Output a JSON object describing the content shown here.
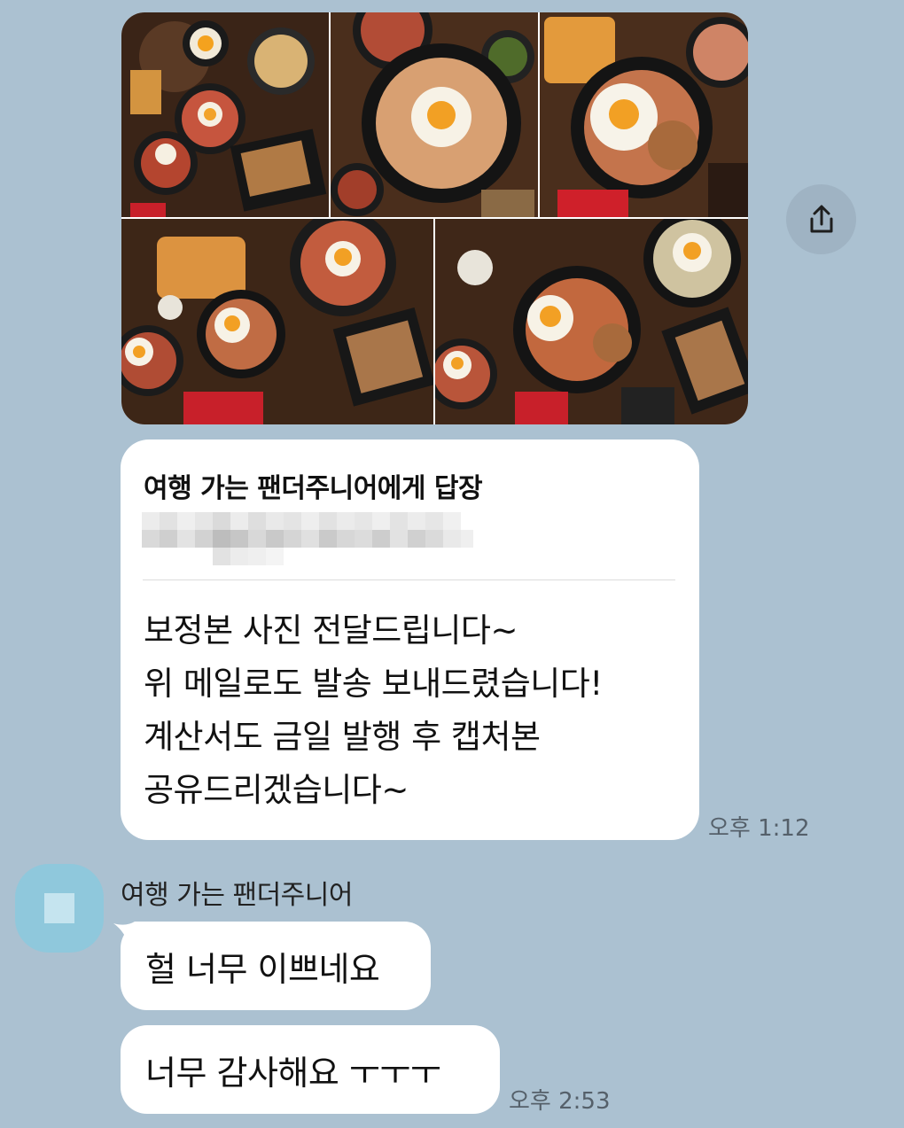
{
  "photos": [
    {
      "alt": "food-photo-1"
    },
    {
      "alt": "food-photo-2"
    },
    {
      "alt": "food-photo-3"
    },
    {
      "alt": "food-photo-4"
    },
    {
      "alt": "food-photo-5"
    }
  ],
  "share_icon": "share-upload-icon",
  "reply": {
    "title": "여행 가는 팬더주니어에게 답장",
    "lines": [
      "보정본 사진 전달드립니다~",
      "위 메일로도 발송 보내드렸습니다!",
      "계산서도 금일 발행 후 캡처본",
      "공유드리겠습니다~"
    ],
    "time": "오후 1:12"
  },
  "incoming": {
    "sender": "여행 가는 팬더주니어",
    "messages": [
      {
        "text": "헐 너무 이쁘네요"
      },
      {
        "text": "너무 감사해요 ㅜㅜㅜ"
      }
    ],
    "time": "오후 2:53"
  },
  "colors": {
    "background": "#abc1d1",
    "bubble": "#ffffff",
    "avatar": "#8fc8dc",
    "share_button": "#9fb3c3"
  }
}
